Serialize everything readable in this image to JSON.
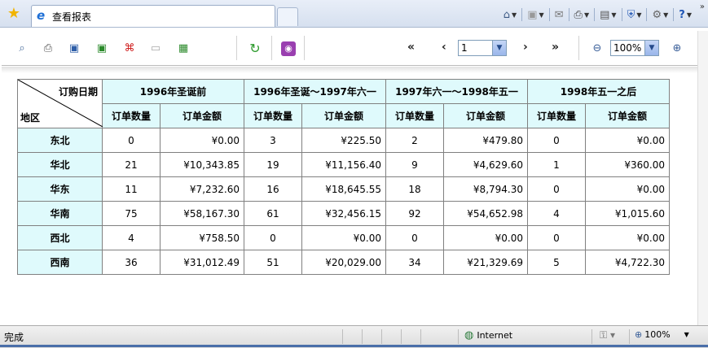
{
  "browser": {
    "tab_title": "查看报表",
    "status_text": "完成",
    "zone_text": "Internet",
    "zoom_text": "100%"
  },
  "toolbar": {
    "page_value": "1",
    "zoom_value": "100%",
    "first": "«",
    "prev": "‹",
    "next": "›",
    "last": "»"
  },
  "report": {
    "corner_top": "订购日期",
    "corner_bottom": "地区",
    "groups": [
      "1996年圣诞前",
      "1996年圣诞～1997年六一",
      "1997年六一～1998年五一",
      "1998年五一之后"
    ],
    "sub_qty": "订单数量",
    "sub_amt": "订单金额",
    "rows": [
      {
        "region": "东北",
        "c": [
          "0",
          "¥0.00",
          "3",
          "¥225.50",
          "2",
          "¥479.80",
          "0",
          "¥0.00"
        ]
      },
      {
        "region": "华北",
        "c": [
          "21",
          "¥10,343.85",
          "19",
          "¥11,156.40",
          "9",
          "¥4,629.60",
          "1",
          "¥360.00"
        ]
      },
      {
        "region": "华东",
        "c": [
          "11",
          "¥7,232.60",
          "16",
          "¥18,645.55",
          "18",
          "¥8,794.30",
          "0",
          "¥0.00"
        ]
      },
      {
        "region": "华南",
        "c": [
          "75",
          "¥58,167.30",
          "61",
          "¥32,456.15",
          "92",
          "¥54,652.98",
          "4",
          "¥1,015.60"
        ]
      },
      {
        "region": "西北",
        "c": [
          "4",
          "¥758.50",
          "0",
          "¥0.00",
          "0",
          "¥0.00",
          "0",
          "¥0.00"
        ]
      },
      {
        "region": "西南",
        "c": [
          "36",
          "¥31,012.49",
          "51",
          "¥20,029.00",
          "34",
          "¥21,329.69",
          "5",
          "¥4,722.30"
        ]
      }
    ]
  },
  "colors": {
    "header_bg": "#dffafc"
  }
}
